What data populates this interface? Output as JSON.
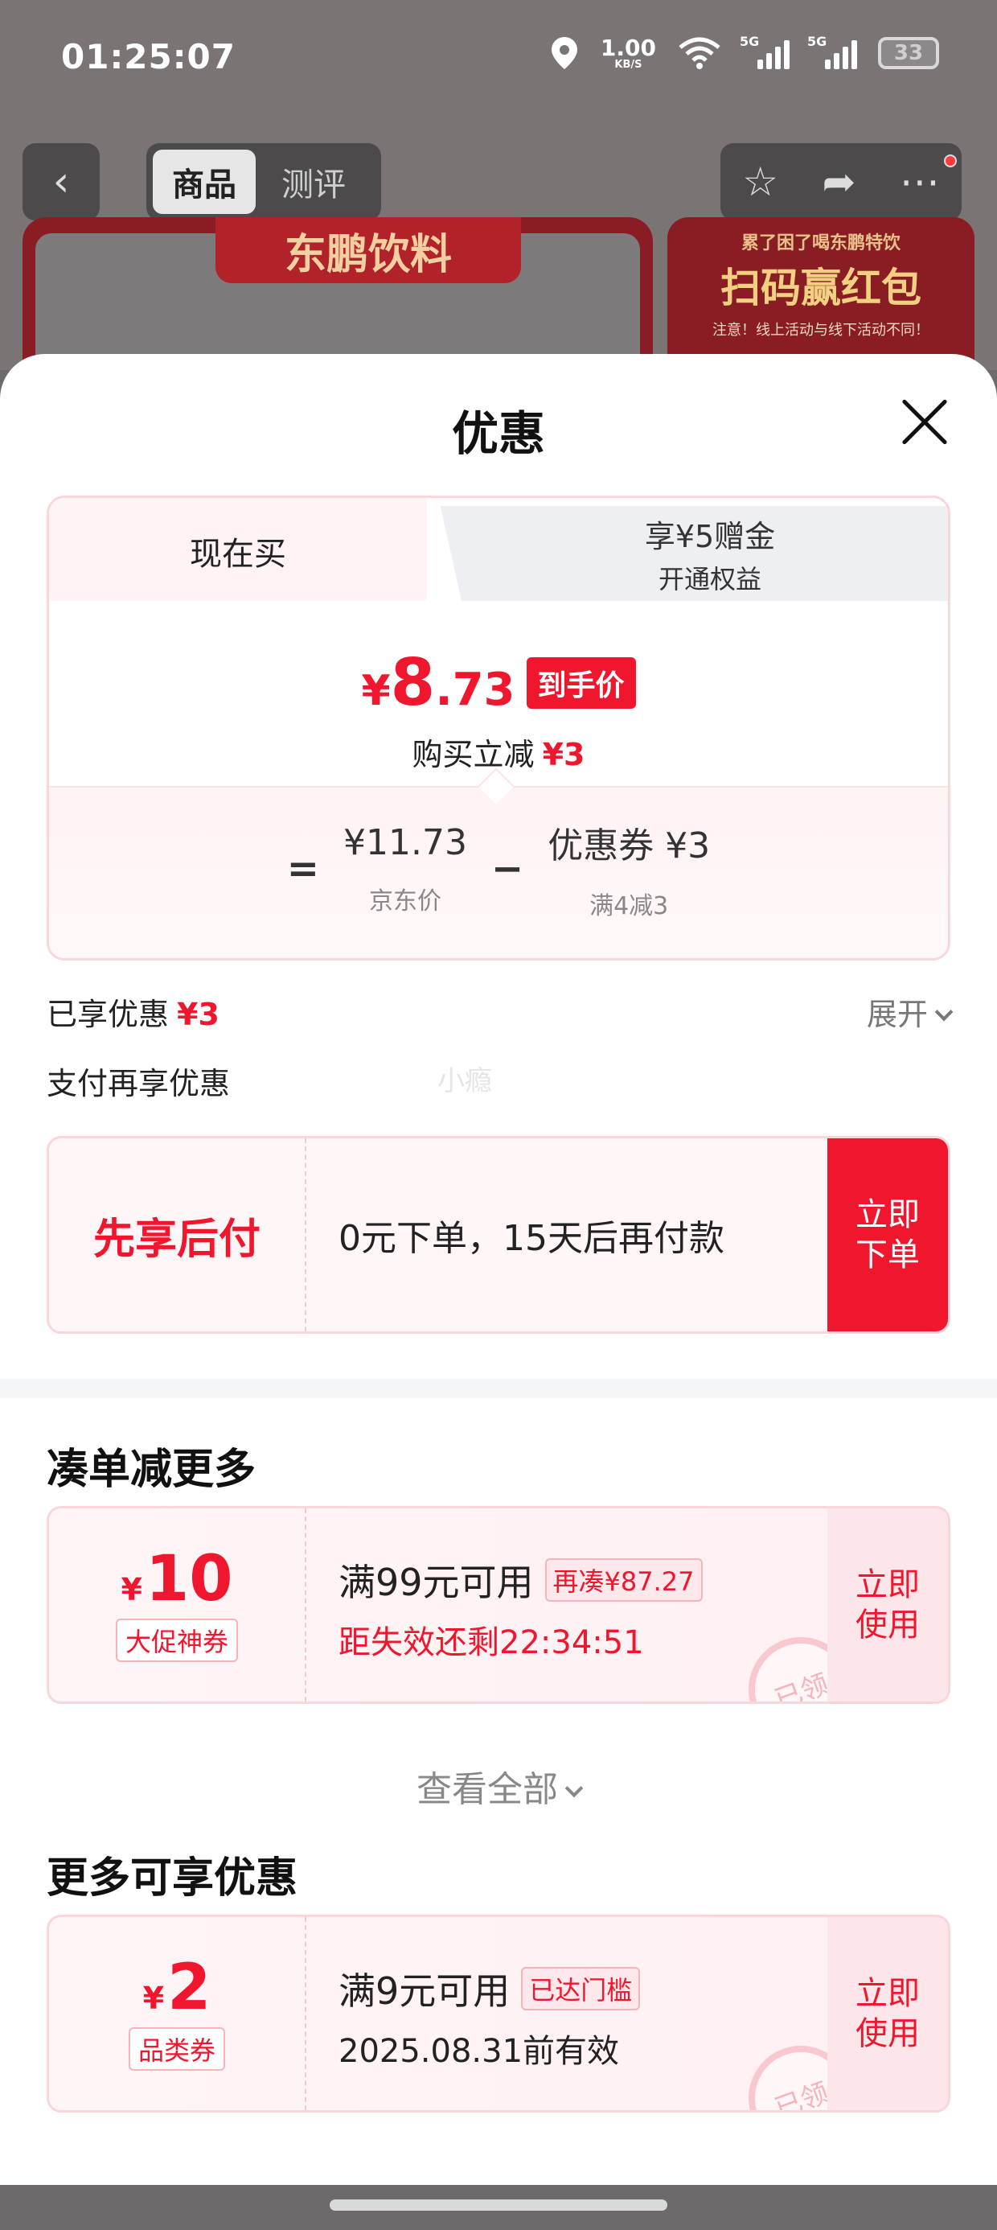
{
  "status_bar": {
    "time": "01:25:07",
    "net_speed": "1.00",
    "net_unit": "KB/S",
    "sig1_label": "5G",
    "sig2_label": "5G",
    "battery": "33"
  },
  "product_nav": {
    "tab_goods": "商品",
    "tab_review": "测评",
    "banner_brand": "东鹏饮料",
    "banner_promo_top": "累了困了喝东鹏特饮",
    "banner_promo_main": "扫码赢红包",
    "banner_promo_note": "注意！线上活动与线下活动不同！"
  },
  "sheet": {
    "title": "优惠",
    "tabs": {
      "now": "现在买",
      "other_line1": "享¥5赠金",
      "other_line2": "开通权益"
    },
    "final_price": {
      "currency": "¥",
      "integer": "8",
      "decimal": ".73",
      "tag": "到手价"
    },
    "reduce": {
      "label": "购买立减",
      "amount": "¥3"
    },
    "calc": {
      "equals": "=",
      "jd_price": "¥11.73",
      "jd_price_label": "京东价",
      "minus": "−",
      "coupon": "优惠券 ¥3",
      "coupon_label": "满4减3"
    },
    "enjoyed": {
      "label": "已享优惠",
      "amount": "¥3",
      "expand": "展开"
    },
    "pay_more": "支付再享优惠",
    "watermark": "小瘾",
    "bnpl": {
      "title": "先享后付",
      "desc": "0元下单，15天后再付款",
      "button": "立即下单"
    },
    "section_bundle": "凑单减更多",
    "coupon_big": {
      "currency": "¥",
      "value": "10",
      "kind": "大促神券",
      "condition": "满99元可用",
      "chip": "再凑¥87.27",
      "countdown": "距失效还剩22:34:51",
      "button": "立即使用",
      "stamp": "已领"
    },
    "view_all": "查看全部",
    "section_more": "更多可享优惠",
    "coupon_small": {
      "currency": "¥",
      "value": "2",
      "kind": "品类券",
      "condition": "满9元可用",
      "chip": "已达门槛",
      "validity": "2025.08.31前有效",
      "button": "立即使用",
      "stamp": "已领"
    }
  },
  "colors": {
    "accent_red": "#f0162e",
    "pink_border": "#fad6da"
  }
}
